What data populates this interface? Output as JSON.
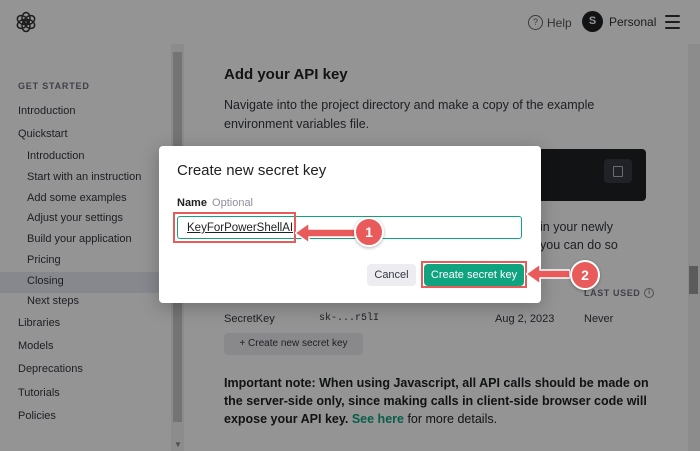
{
  "topbar": {
    "help": "Help",
    "avatar_letter": "S",
    "account": "Personal"
  },
  "sidebar": {
    "section": "GET STARTED",
    "items": [
      {
        "label": "Introduction"
      },
      {
        "label": "Quickstart"
      },
      {
        "label": "Introduction"
      },
      {
        "label": "Start with an instruction"
      },
      {
        "label": "Add some examples"
      },
      {
        "label": "Adjust your settings"
      },
      {
        "label": "Build your application"
      },
      {
        "label": "Pricing"
      },
      {
        "label": "Closing"
      },
      {
        "label": "Next steps"
      },
      {
        "label": "Libraries"
      },
      {
        "label": "Models"
      },
      {
        "label": "Deprecations"
      },
      {
        "label": "Tutorials"
      },
      {
        "label": "Policies"
      }
    ]
  },
  "main": {
    "heading": "Add your API key",
    "paragraph": "Navigate into the project directory and make a copy of the example environment variables file.",
    "side_line1": "in your newly",
    "side_line2": "you can do so",
    "table_header_last_used": "LAST USED",
    "row": {
      "name": "SecretKey",
      "key": "sk-...r5lI",
      "created": "Aug 2, 2023",
      "last_used": "Never"
    },
    "create_new_button": "+ Create new secret key",
    "note_bold": "Important note: When using Javascript, all API calls should be made on the server-side only, since making calls in client-side browser code will expose your API key.",
    "note_link": "See here",
    "note_tail": "for more details."
  },
  "modal": {
    "title": "Create new secret key",
    "name_label": "Name",
    "optional_label": "Optional",
    "name_value": "KeyForPowerShellAI",
    "cancel": "Cancel",
    "create": "Create secret key"
  },
  "annotations": {
    "step1": "1",
    "step2": "2"
  },
  "colors": {
    "accent": "#10a37f",
    "annotation": "#e95b5b"
  }
}
